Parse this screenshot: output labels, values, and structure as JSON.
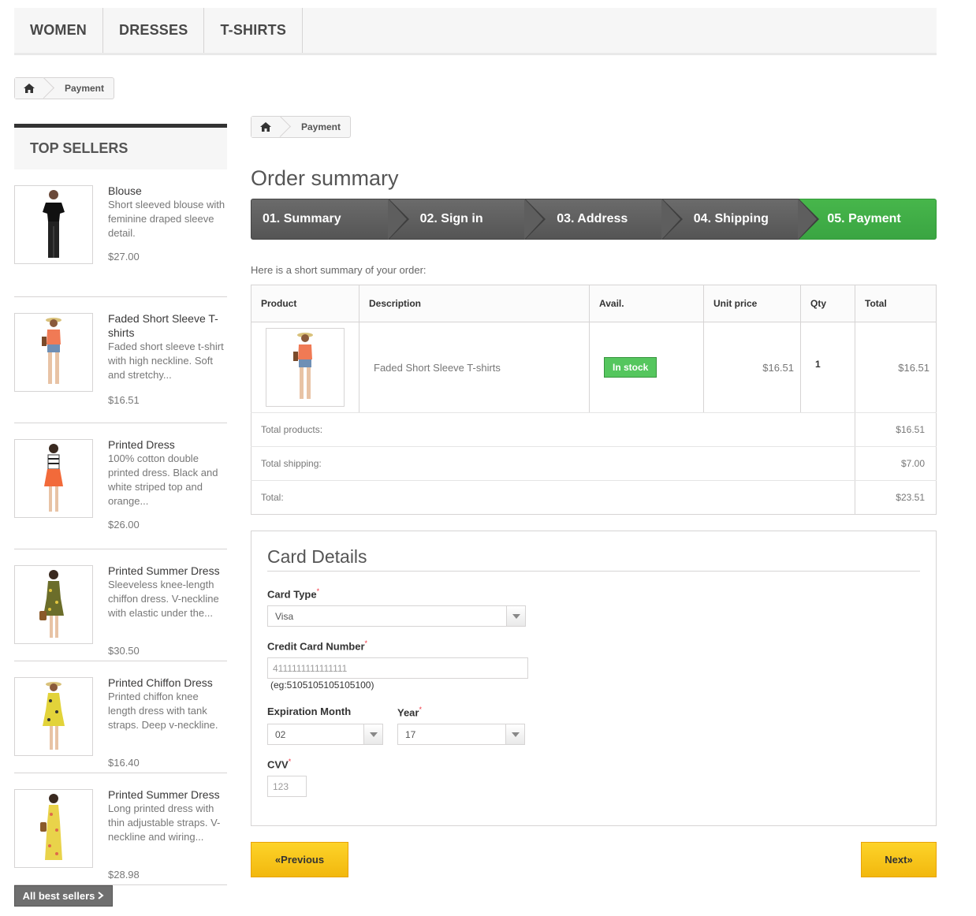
{
  "menu": [
    "Women",
    "Dresses",
    "T-shirts"
  ],
  "breadcrumb": {
    "current": "Payment"
  },
  "sidebar": {
    "title": "Top sellers",
    "items": [
      {
        "name": "Blouse",
        "desc": "Short sleeved blouse with feminine draped sleeve detail.",
        "price": "$27.00"
      },
      {
        "name": "Faded Short Sleeve T-shirts",
        "desc": "Faded short sleeve t-shirt with high neckline. Soft and stretchy...",
        "price": "$16.51"
      },
      {
        "name": "Printed Dress",
        "desc": "100% cotton double printed dress. Black and white striped top and orange...",
        "price": "$26.00"
      },
      {
        "name": "Printed Summer Dress",
        "desc": "Sleeveless knee-length chiffon dress. V-neckline with elastic under the...",
        "price": "$30.50"
      },
      {
        "name": "Printed Chiffon Dress",
        "desc": "Printed chiffon knee length dress with tank straps. Deep v-neckline.",
        "price": "$16.40"
      },
      {
        "name": "Printed Summer Dress",
        "desc": "Long printed dress with thin adjustable straps. V-neckline and wiring...",
        "price": "$28.98"
      }
    ],
    "all_label": "All best sellers"
  },
  "main": {
    "title": "Order summary",
    "steps": [
      "01. Summary",
      "02. Sign in",
      "03. Address",
      "04. Shipping",
      "05. Payment"
    ],
    "intro": "Here is a short summary of your order:",
    "table": {
      "headers": [
        "Product",
        "Description",
        "Avail.",
        "Unit price",
        "Qty",
        "Total"
      ],
      "row": {
        "description": "Faded Short Sleeve T-shirts",
        "avail": "In stock",
        "unit_price": "$16.51",
        "qty": "1",
        "total": "$16.51"
      },
      "totals": [
        {
          "label": "Total products:",
          "value": "$16.51"
        },
        {
          "label": "Total shipping:",
          "value": "$7.00"
        },
        {
          "label": "Total:",
          "value": "$23.51"
        }
      ]
    },
    "card": {
      "title": "Card Details",
      "card_type_label": "Card Type",
      "card_type_value": "Visa",
      "number_label": "Credit Card Number",
      "number_value": "4111111111111111",
      "number_hint": "(eg:5105105105105100)",
      "month_label": "Expiration Month",
      "month_value": "02",
      "year_label": "Year",
      "year_value": "17",
      "cvv_label": "CVV",
      "cvv_placeholder": "123"
    },
    "buttons": {
      "previous": "«Previous",
      "next": "Next»"
    }
  },
  "colors": {
    "accent_green": "#46b44a",
    "button_yellow": "#f7c517",
    "dark_step": "#5f5f5f"
  }
}
